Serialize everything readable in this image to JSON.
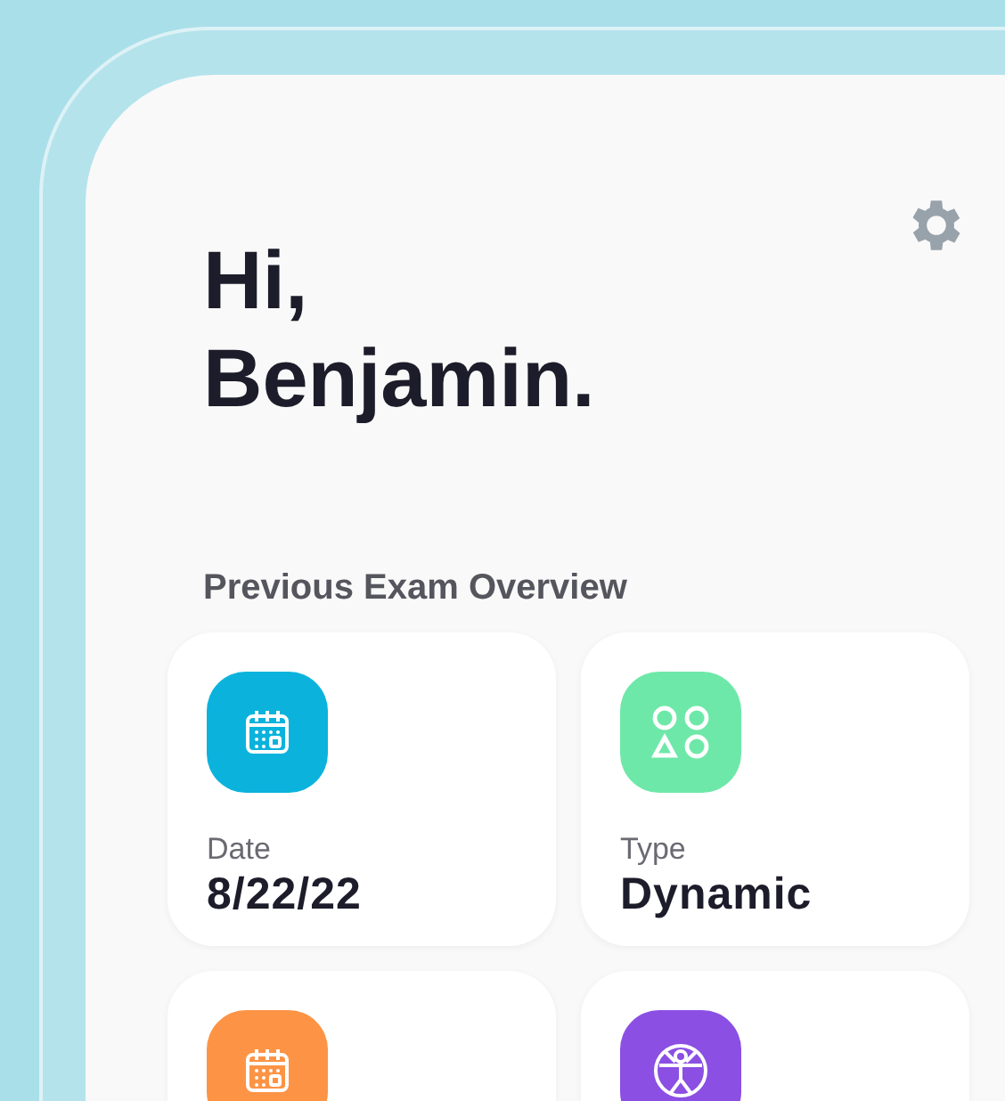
{
  "greeting": {
    "lines": [
      "Hi,",
      "Benjamin."
    ]
  },
  "section": {
    "title": "Previous Exam Overview"
  },
  "cards": [
    {
      "kind": "calendar",
      "color": "#0bb3dc",
      "label": "Date",
      "value": "8/22/22"
    },
    {
      "kind": "shapes",
      "color": "#6ee8a8",
      "label": "Type",
      "value": "Dynamic"
    },
    {
      "kind": "calendar",
      "color": "#fd9445"
    },
    {
      "kind": "figure",
      "color": "#8b4fe3"
    }
  ]
}
